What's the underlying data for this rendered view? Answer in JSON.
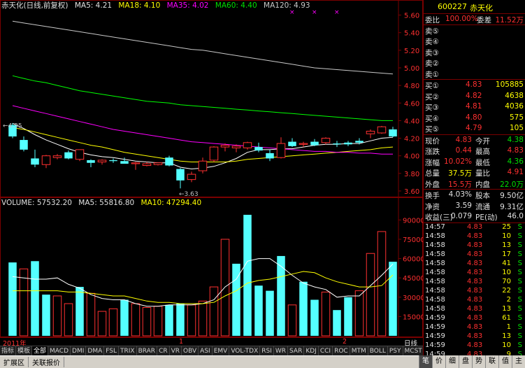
{
  "legend": {
    "title": "赤天化(日线,前复权)",
    "ma5": "MA5: 4.21",
    "ma18": "MA18: 4.10",
    "ma35": "MA35: 4.02",
    "ma60": "MA60: 4.40",
    "ma120": "MA120: 4.93"
  },
  "volume_legend": {
    "label": "VOLUME: 57532.20",
    "ma5": "MA5: 55816.80",
    "ma10": "MA10: 47294.40"
  },
  "annotations": {
    "high": "4.35",
    "low": "3.63",
    "marker": "×"
  },
  "chart_data": [
    {
      "type": "candlestick",
      "title": "赤天化(日线,前复权)",
      "yaxis_ticks": [
        "5.60",
        "5.40",
        "5.20",
        "5.00",
        "4.80",
        "4.60",
        "4.40",
        "4.20",
        "4.00",
        "3.80",
        "3.60"
      ],
      "ylim": [
        3.56,
        5.66
      ],
      "candles": [
        {
          "o": 4.35,
          "h": 4.37,
          "l": 4.2,
          "c": 4.22
        },
        {
          "o": 4.18,
          "h": 4.22,
          "l": 4.05,
          "c": 4.07
        },
        {
          "o": 3.97,
          "h": 4.07,
          "l": 3.87,
          "c": 3.9
        },
        {
          "o": 3.9,
          "h": 4.01,
          "l": 3.86,
          "c": 4.0
        },
        {
          "o": 3.98,
          "h": 4.02,
          "l": 3.96,
          "c": 4.0
        },
        {
          "o": 4.04,
          "h": 4.06,
          "l": 3.96,
          "c": 3.97
        },
        {
          "o": 3.96,
          "h": 4.07,
          "l": 3.94,
          "c": 4.07
        },
        {
          "o": 3.95,
          "h": 3.96,
          "l": 3.87,
          "c": 3.92
        },
        {
          "o": 3.93,
          "h": 3.96,
          "l": 3.9,
          "c": 3.95
        },
        {
          "o": 3.95,
          "h": 3.97,
          "l": 3.92,
          "c": 3.94
        },
        {
          "o": 3.94,
          "h": 3.98,
          "l": 3.91,
          "c": 3.91
        },
        {
          "o": 3.91,
          "h": 3.93,
          "l": 3.84,
          "c": 3.92
        },
        {
          "o": 3.89,
          "h": 3.93,
          "l": 3.88,
          "c": 3.91
        },
        {
          "o": 3.9,
          "h": 3.92,
          "l": 3.89,
          "c": 3.92
        },
        {
          "o": 3.98,
          "h": 4.0,
          "l": 3.88,
          "c": 3.89
        },
        {
          "o": 3.85,
          "h": 3.86,
          "l": 3.63,
          "c": 3.72
        },
        {
          "o": 3.73,
          "h": 3.82,
          "l": 3.7,
          "c": 3.79
        },
        {
          "o": 3.83,
          "h": 3.98,
          "l": 3.8,
          "c": 3.94
        },
        {
          "o": 3.95,
          "h": 4.11,
          "l": 3.93,
          "c": 4.1
        },
        {
          "o": 4.1,
          "h": 4.14,
          "l": 4.05,
          "c": 4.12
        },
        {
          "o": 4.09,
          "h": 4.13,
          "l": 4.04,
          "c": 4.11
        },
        {
          "o": 4.09,
          "h": 4.16,
          "l": 4.07,
          "c": 4.15
        },
        {
          "o": 4.1,
          "h": 4.15,
          "l": 4.04,
          "c": 4.06
        },
        {
          "o": 4.03,
          "h": 4.07,
          "l": 3.94,
          "c": 3.97
        },
        {
          "o": 3.98,
          "h": 4.21,
          "l": 3.97,
          "c": 4.14
        },
        {
          "o": 4.16,
          "h": 4.2,
          "l": 4.1,
          "c": 4.11
        },
        {
          "o": 4.13,
          "h": 4.16,
          "l": 4.1,
          "c": 4.14
        },
        {
          "o": 4.16,
          "h": 4.19,
          "l": 4.11,
          "c": 4.12
        },
        {
          "o": 4.15,
          "h": 4.21,
          "l": 4.13,
          "c": 4.2
        },
        {
          "o": 4.14,
          "h": 4.17,
          "l": 4.1,
          "c": 4.13
        },
        {
          "o": 4.15,
          "h": 4.17,
          "l": 4.11,
          "c": 4.13
        },
        {
          "o": 4.17,
          "h": 4.2,
          "l": 4.13,
          "c": 4.15
        },
        {
          "o": 4.25,
          "h": 4.3,
          "l": 4.2,
          "c": 4.28
        },
        {
          "o": 4.26,
          "h": 4.34,
          "l": 4.25,
          "c": 4.33
        },
        {
          "o": 4.3,
          "h": 4.33,
          "l": 4.21,
          "c": 4.22
        }
      ],
      "ma_series": [
        {
          "name": "MA5",
          "color": "#ffffff",
          "values": [
            4.37,
            4.31,
            4.24,
            4.18,
            4.13,
            4.08,
            4.04,
            4.01,
            3.99,
            3.98,
            3.96,
            3.94,
            3.93,
            3.92,
            3.92,
            3.87,
            3.85,
            3.86,
            3.88,
            3.92,
            3.97,
            4.04,
            4.07,
            4.07,
            4.08,
            4.08,
            4.1,
            4.12,
            4.13,
            4.13,
            4.14,
            4.14,
            4.17,
            4.2,
            4.21
          ]
        },
        {
          "name": "MA18",
          "color": "#ffff00",
          "values": [
            4.32,
            4.3,
            4.27,
            4.24,
            4.21,
            4.18,
            4.15,
            4.12,
            4.1,
            4.07,
            4.04,
            4.02,
            4.0,
            3.98,
            3.96,
            3.94,
            3.93,
            3.93,
            3.93,
            3.93,
            3.94,
            3.96,
            3.97,
            3.98,
            3.99,
            4.0,
            4.01,
            4.02,
            4.03,
            4.04,
            4.05,
            4.06,
            4.07,
            4.09,
            4.1
          ]
        },
        {
          "name": "MA35",
          "color": "#ff00ff",
          "values": [
            4.57,
            4.54,
            4.51,
            4.48,
            4.45,
            4.42,
            4.39,
            4.36,
            4.33,
            4.3,
            4.28,
            4.26,
            4.24,
            4.22,
            4.2,
            4.18,
            4.16,
            4.15,
            4.14,
            4.13,
            4.12,
            4.11,
            4.1,
            4.09,
            4.08,
            4.07,
            4.06,
            4.05,
            4.05,
            4.04,
            4.04,
            4.03,
            4.03,
            4.02,
            4.02
          ]
        },
        {
          "name": "MA60",
          "color": "#00ff00",
          "values": [
            4.91,
            4.88,
            4.85,
            4.83,
            4.8,
            4.77,
            4.74,
            4.72,
            4.7,
            4.68,
            4.66,
            4.64,
            4.62,
            4.61,
            4.6,
            4.58,
            4.57,
            4.56,
            4.55,
            4.54,
            4.53,
            4.52,
            4.51,
            4.5,
            4.49,
            4.48,
            4.47,
            4.46,
            4.45,
            4.44,
            4.43,
            4.42,
            4.41,
            4.4,
            4.4
          ]
        },
        {
          "name": "MA120",
          "color": "#c8c8c8",
          "values": [
            5.53,
            5.51,
            5.49,
            5.47,
            5.45,
            5.43,
            5.41,
            5.39,
            5.37,
            5.35,
            5.33,
            5.31,
            5.29,
            5.27,
            5.25,
            5.23,
            5.21,
            5.2,
            5.18,
            5.16,
            5.14,
            5.12,
            5.1,
            5.08,
            5.06,
            5.04,
            5.02,
            5.0,
            4.99,
            4.98,
            4.97,
            4.96,
            4.95,
            4.94,
            4.93
          ]
        }
      ]
    },
    {
      "type": "bar",
      "title": "VOLUME",
      "yaxis_ticks": [
        "90000",
        "75000",
        "60000",
        "45000",
        "30000",
        "15000"
      ],
      "ylim": [
        0,
        100000
      ],
      "values": [
        57000,
        52000,
        58000,
        32000,
        31000,
        25000,
        38000,
        33000,
        19000,
        21000,
        28000,
        25000,
        22000,
        23000,
        24000,
        25000,
        24000,
        27000,
        38000,
        75000,
        56000,
        94000,
        39000,
        35000,
        62000,
        24000,
        42000,
        28000,
        34000,
        20000,
        30000,
        35000,
        64000,
        81000,
        57532
      ],
      "up": [
        false,
        true,
        false,
        false,
        true,
        true,
        false,
        true,
        true,
        true,
        false,
        true,
        true,
        true,
        false,
        false,
        true,
        true,
        true,
        true,
        false,
        false,
        false,
        false,
        false,
        true,
        false,
        false,
        true,
        false,
        false,
        true,
        true,
        true,
        false
      ],
      "ma_series": [
        {
          "name": "MA5",
          "color": "#ffffff",
          "values": [
            46000,
            45000,
            44000,
            44000,
            45000,
            40000,
            37000,
            32000,
            29000,
            28000,
            28000,
            25000,
            23000,
            23000,
            24000,
            24000,
            24000,
            25000,
            28000,
            38000,
            44000,
            58000,
            60000,
            60000,
            54000,
            47000,
            41000,
            38000,
            36000,
            30000,
            31000,
            31000,
            39000,
            47000,
            55816
          ]
        },
        {
          "name": "MA10",
          "color": "#ffff00",
          "values": [
            35000,
            35000,
            35000,
            35000,
            35000,
            34000,
            34000,
            33000,
            32000,
            31000,
            31000,
            29000,
            27000,
            26000,
            26000,
            25000,
            25000,
            25000,
            26000,
            31000,
            35000,
            41000,
            43000,
            44000,
            46000,
            48000,
            50000,
            49000,
            45000,
            42000,
            40000,
            38000,
            38000,
            39000,
            47294
          ]
        }
      ],
      "up_color": "#ff3030",
      "down_color": "#54ffff"
    }
  ],
  "time_axis": {
    "left": "2011年",
    "mid": "1",
    "right": "2",
    "period": "日线"
  },
  "panel": {
    "code": "600227",
    "name": "赤天化",
    "weibi_label": "委比",
    "weibi_value": "100.00%",
    "weicha_label": "委差",
    "weicha_value": "11.52万",
    "sell": [
      {
        "label": "卖⑤",
        "price": "",
        "vol": ""
      },
      {
        "label": "卖④",
        "price": "",
        "vol": ""
      },
      {
        "label": "卖③",
        "price": "",
        "vol": ""
      },
      {
        "label": "卖②",
        "price": "",
        "vol": ""
      },
      {
        "label": "卖①",
        "price": "",
        "vol": ""
      }
    ],
    "buy": [
      {
        "label": "买①",
        "price": "4.83",
        "vol": "105885"
      },
      {
        "label": "买②",
        "price": "4.82",
        "vol": "4638"
      },
      {
        "label": "买③",
        "price": "4.81",
        "vol": "4036"
      },
      {
        "label": "买④",
        "price": "4.80",
        "vol": "575"
      },
      {
        "label": "买⑤",
        "price": "4.79",
        "vol": "105"
      }
    ],
    "stats": [
      [
        {
          "l": "现价",
          "v": "4.83",
          "c": "red"
        },
        {
          "l": "今开",
          "v": "4.38",
          "c": "grn"
        }
      ],
      [
        {
          "l": "涨跌",
          "v": "0.44",
          "c": "red"
        },
        {
          "l": "最高",
          "v": "4.83",
          "c": "red"
        }
      ],
      [
        {
          "l": "涨幅",
          "v": "10.02%",
          "c": "red"
        },
        {
          "l": "最低",
          "v": "4.36",
          "c": "grn"
        }
      ],
      [
        {
          "l": "总量",
          "v": "37.5万",
          "c": "yel"
        },
        {
          "l": "量比",
          "v": "4.91",
          "c": "red"
        }
      ],
      [
        {
          "l": "外盘",
          "v": "15.5万",
          "c": "red"
        },
        {
          "l": "内盘",
          "v": "22.0万",
          "c": "grn"
        }
      ]
    ],
    "fund": [
      [
        {
          "l": "换手",
          "v": "4.03%"
        },
        {
          "l": "股本",
          "v": "9.50亿"
        }
      ],
      [
        {
          "l": "净资",
          "v": "3.59"
        },
        {
          "l": "流通",
          "v": "9.31亿"
        }
      ],
      [
        {
          "l": "收益(三)",
          "v": "0.079"
        },
        {
          "l": "PE(动)",
          "v": "46.0"
        }
      ]
    ],
    "ticks": [
      {
        "t": "14:57",
        "p": "4.83",
        "v": "25",
        "s": "S"
      },
      {
        "t": "14:58",
        "p": "4.83",
        "v": "10",
        "s": "S"
      },
      {
        "t": "14:58",
        "p": "4.83",
        "v": "13",
        "s": "S"
      },
      {
        "t": "14:58",
        "p": "4.83",
        "v": "17",
        "s": "S"
      },
      {
        "t": "14:58",
        "p": "4.83",
        "v": "41",
        "s": "S"
      },
      {
        "t": "14:58",
        "p": "4.83",
        "v": "10",
        "s": "S"
      },
      {
        "t": "14:58",
        "p": "4.83",
        "v": "70",
        "s": "S"
      },
      {
        "t": "14:58",
        "p": "4.83",
        "v": "22",
        "s": "S"
      },
      {
        "t": "14:58",
        "p": "4.83",
        "v": "2",
        "s": "S"
      },
      {
        "t": "14:58",
        "p": "4.83",
        "v": "13",
        "s": "S"
      },
      {
        "t": "14:59",
        "p": "4.83",
        "v": "61",
        "s": "S"
      },
      {
        "t": "14:59",
        "p": "4.83",
        "v": "1",
        "s": "S"
      },
      {
        "t": "14:59",
        "p": "4.83",
        "v": "13",
        "s": "S"
      },
      {
        "t": "14:59",
        "p": "4.83",
        "v": "10",
        "s": "S"
      },
      {
        "t": "14:59",
        "p": "4.83",
        "v": "9",
        "s": "S"
      }
    ]
  },
  "tabs": [
    "指标",
    "模板",
    "全部",
    "MACD",
    "DMI",
    "DMA",
    "FSL",
    "TRIX",
    "BRAR",
    "CR",
    "VR",
    "OBV",
    "ASI",
    "EMV",
    "VOL-TDX",
    "RSI",
    "WR",
    "SAR",
    "KDJ",
    "CCI",
    "ROC",
    "MTM",
    "BOLL",
    "PSY",
    "MCST"
  ],
  "status": [
    "扩展区",
    "关联报价"
  ],
  "right_tabs": [
    "笔",
    "价",
    "细",
    "盘",
    "势",
    "联",
    "值",
    "主"
  ]
}
